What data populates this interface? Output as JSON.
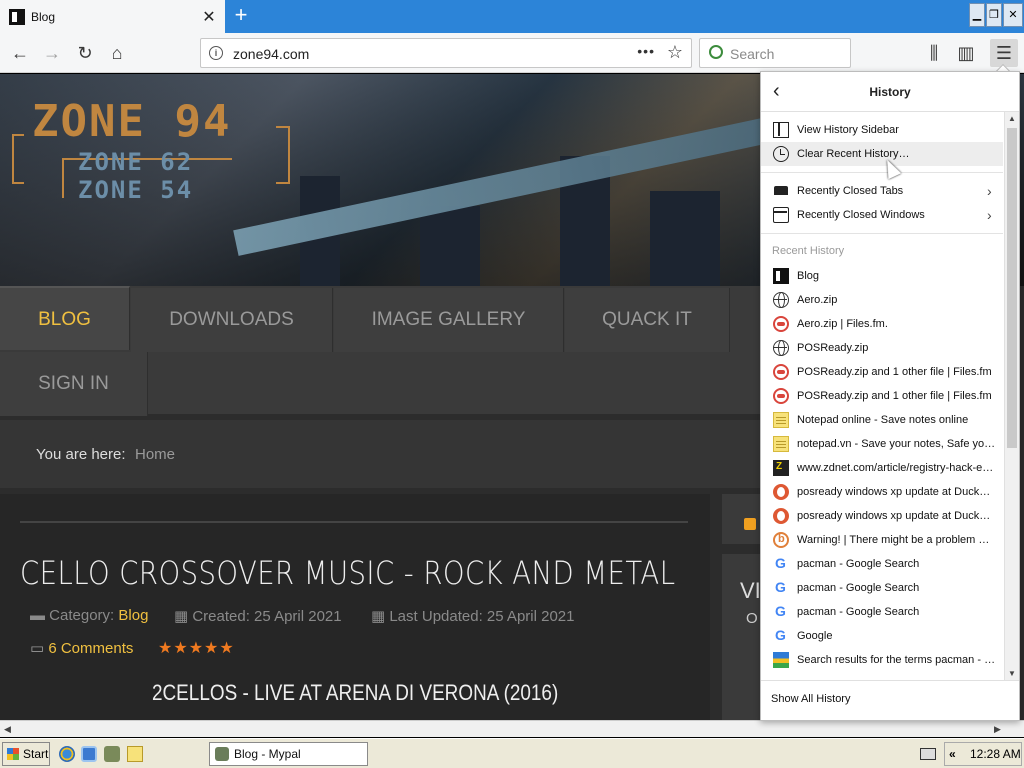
{
  "tab": {
    "title": "Blog",
    "close": "✕"
  },
  "newtab": "+",
  "window": {
    "min": "▁",
    "restore": "❐",
    "close": "✕"
  },
  "toolbar": {
    "back": "←",
    "forward": "→",
    "reload": "↻",
    "home": "⌂",
    "library": "⫼",
    "sidebar": "▥",
    "menu": "☰"
  },
  "urlbar": {
    "url": "zone94.com",
    "info": "i",
    "dots": "•••",
    "star": "☆"
  },
  "search": {
    "placeholder": "Search"
  },
  "site": {
    "logo": {
      "line1": "ZONE 94",
      "line2": "ZONE 62",
      "line3": "ZONE 54"
    },
    "nav": [
      "BLOG",
      "DOWNLOADS",
      "IMAGE GALLERY",
      "QUACK IT",
      "SIGN IN"
    ],
    "breadcrumb": {
      "label": "You are here:",
      "value": "Home"
    },
    "article": {
      "title": "CELLO CROSSOVER MUSIC - ROCK AND METAL",
      "category_label": "Category:",
      "category": "Blog",
      "created": "Created: 25 April 2021",
      "updated": "Last Updated: 25 April 2021",
      "comments": "6 Comments",
      "stars": "★★★★★",
      "subtitle": "2CELLOS - LIVE AT ARENA DI VERONA (2016)"
    },
    "side": {
      "v": "VI",
      "o": "O"
    }
  },
  "history": {
    "title": "History",
    "back": "‹",
    "actions": [
      {
        "label": "View History Sidebar",
        "icon": "sidebar-icon"
      },
      {
        "label": "Clear Recent History…",
        "icon": "clear-history-icon"
      }
    ],
    "closed": [
      {
        "label": "Recently Closed Tabs",
        "icon": "tabs-icon"
      },
      {
        "label": "Recently Closed Windows",
        "icon": "window-icon"
      }
    ],
    "section_label": "Recent History",
    "items": [
      {
        "label": "Blog",
        "icon": "blog"
      },
      {
        "label": "Aero.zip",
        "icon": "globe"
      },
      {
        "label": "Aero.zip | Files.fm.",
        "icon": "files"
      },
      {
        "label": "POSReady.zip",
        "icon": "globe"
      },
      {
        "label": "POSReady.zip and 1 other file | Files.fm",
        "icon": "files"
      },
      {
        "label": "POSReady.zip and 1 other file | Files.fm",
        "icon": "files"
      },
      {
        "label": "Notepad online - Save notes online",
        "icon": "note"
      },
      {
        "label": "notepad.vn - Save your notes, Safe your time",
        "icon": "note"
      },
      {
        "label": "www.zdnet.com/article/registry-hack-enables",
        "icon": "zd"
      },
      {
        "label": "posready windows xp update at DuckDuckGo",
        "icon": "duck"
      },
      {
        "label": "posready windows xp update at DuckDuckGo",
        "icon": "duck"
      },
      {
        "label": "Warning! | There might be a problem with",
        "icon": "warn"
      },
      {
        "label": "pacman - Google Search",
        "icon": "g"
      },
      {
        "label": "pacman - Google Search",
        "icon": "g"
      },
      {
        "label": "pacman - Google Search",
        "icon": "g"
      },
      {
        "label": "Google",
        "icon": "g"
      },
      {
        "label": "Search results for the terms pacman - Internet Archive",
        "icon": "sr"
      }
    ],
    "footer": "Show All History"
  },
  "taskbar": {
    "start": "Start",
    "task": "Blog - Mypal",
    "tray_arrows": "«",
    "clock": "12:28 AM"
  }
}
